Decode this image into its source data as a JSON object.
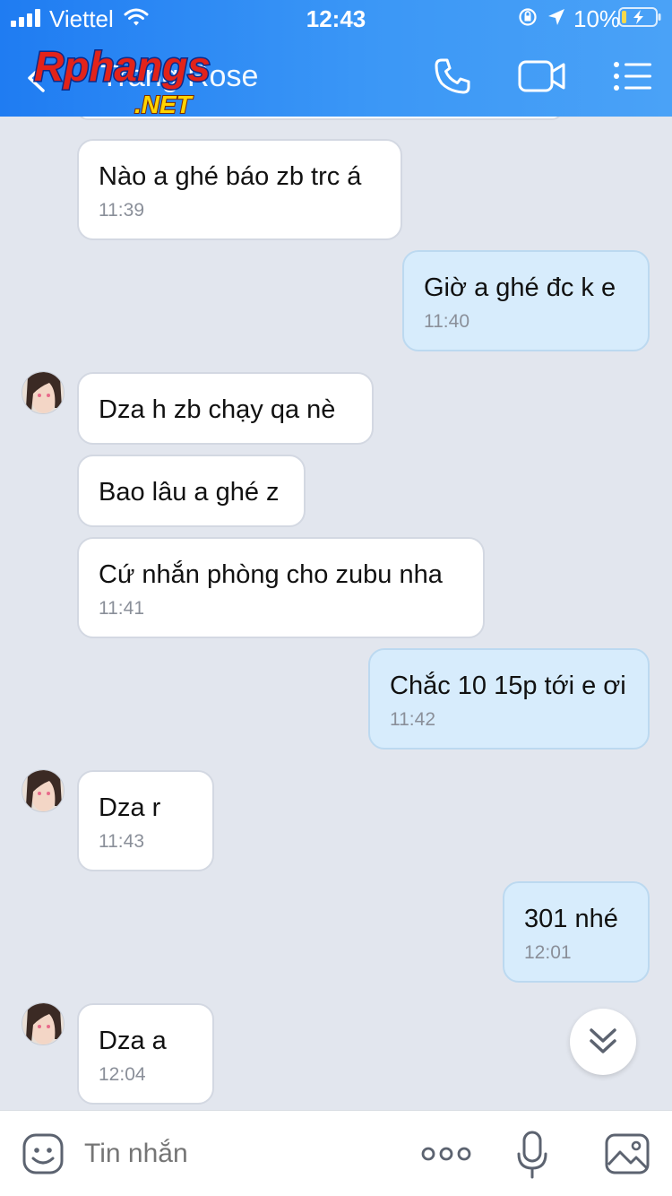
{
  "status_bar": {
    "carrier": "Viettel",
    "time": "12:43",
    "battery_percent": "10%"
  },
  "header": {
    "contact_name": "Trang Rose",
    "watermark_text": "Rphangs",
    "watermark_sub": ".NET"
  },
  "messages": [
    {
      "direction": "in",
      "text": "Nào a ghé báo zb trc á",
      "time": "11:39"
    },
    {
      "direction": "out",
      "text": "Giờ a ghé đc k e",
      "time": "11:40"
    },
    {
      "direction": "in",
      "text": "Dza h zb chạy qa nè",
      "time": ""
    },
    {
      "direction": "in",
      "text": "Bao lâu a ghé z",
      "time": ""
    },
    {
      "direction": "in",
      "text": "Cứ nhắn phòng cho zubu nha",
      "time": "11:41"
    },
    {
      "direction": "out",
      "text": "Chắc 10 15p tới e ơi",
      "time": "11:42"
    },
    {
      "direction": "in",
      "text": "Dza r",
      "time": "11:43"
    },
    {
      "direction": "out",
      "text": "301 nhé",
      "time": "12:01"
    },
    {
      "direction": "in",
      "text": "Dza a",
      "time": "12:04"
    }
  ],
  "input_bar": {
    "placeholder": "Tin nhắn"
  },
  "colors": {
    "header_start": "#1f7cf2",
    "header_end": "#4aa2f7",
    "chat_background": "#e2e6ee",
    "incoming_bubble": "#ffffff",
    "outgoing_bubble": "#d7ecfc"
  },
  "icons": [
    "signal-icon",
    "wifi-icon",
    "rotation-lock-icon",
    "location-icon",
    "battery-icon",
    "back-icon",
    "phone-icon",
    "video-call-icon",
    "menu-icon",
    "chevron-double-down-icon",
    "sticker-icon",
    "more-icon",
    "microphone-icon",
    "image-icon"
  ]
}
